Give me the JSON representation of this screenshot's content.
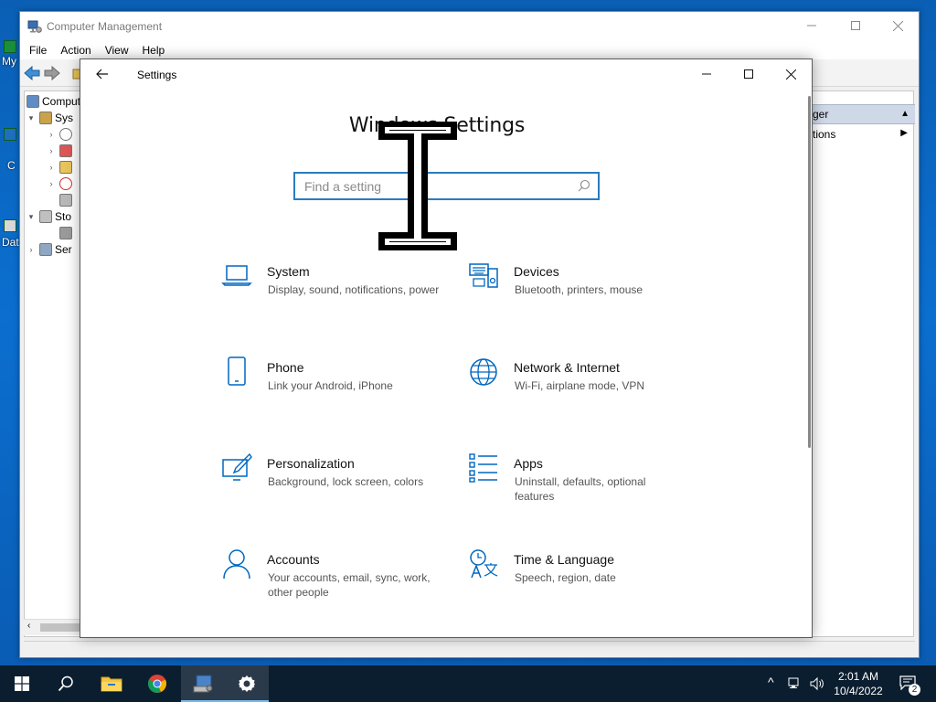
{
  "desktop": {
    "label_1": "My",
    "label_2": "C",
    "label_3": "Dat"
  },
  "computer_management": {
    "title": "Computer Management",
    "menu": [
      "File",
      "Action",
      "View",
      "Help"
    ],
    "tree": [
      {
        "label": "Comput",
        "expanded": null
      },
      {
        "label": "Sys",
        "expanded": true
      },
      {
        "label": "",
        "expanded": false
      },
      {
        "label": "",
        "expanded": false
      },
      {
        "label": "",
        "expanded": false
      },
      {
        "label": "",
        "expanded": false
      },
      {
        "label": "",
        "expanded": null
      },
      {
        "label": "Sto",
        "expanded": true
      },
      {
        "label": "",
        "expanded": null
      },
      {
        "label": "Ser",
        "expanded": false
      }
    ],
    "actions": {
      "header": "ger",
      "item": "tions"
    }
  },
  "settings": {
    "title": "Settings",
    "heading": "Windows Settings",
    "search": {
      "placeholder": "Find a setting",
      "value": ""
    },
    "tiles": [
      {
        "name": "System",
        "desc": "Display, sound, notifications, power",
        "icon": "laptop-icon"
      },
      {
        "name": "Devices",
        "desc": "Bluetooth, printers, mouse",
        "icon": "devices-icon"
      },
      {
        "name": "Phone",
        "desc": "Link your Android, iPhone",
        "icon": "phone-icon"
      },
      {
        "name": "Network & Internet",
        "desc": "Wi-Fi, airplane mode, VPN",
        "icon": "globe-icon"
      },
      {
        "name": "Personalization",
        "desc": "Background, lock screen, colors",
        "icon": "paint-icon"
      },
      {
        "name": "Apps",
        "desc": "Uninstall, defaults, optional features",
        "icon": "apps-list-icon"
      },
      {
        "name": "Accounts",
        "desc": "Your accounts, email, sync, work, other people",
        "icon": "person-icon"
      },
      {
        "name": "Time & Language",
        "desc": "Speech, region, date",
        "icon": "time-language-icon"
      }
    ]
  },
  "taskbar": {
    "time": "2:01 AM",
    "date": "10/4/2022",
    "notification_count": "2"
  },
  "colors": {
    "accent": "#0067c0",
    "desktop_blue": "#0b6fd0",
    "taskbar": "#0b1e30"
  }
}
